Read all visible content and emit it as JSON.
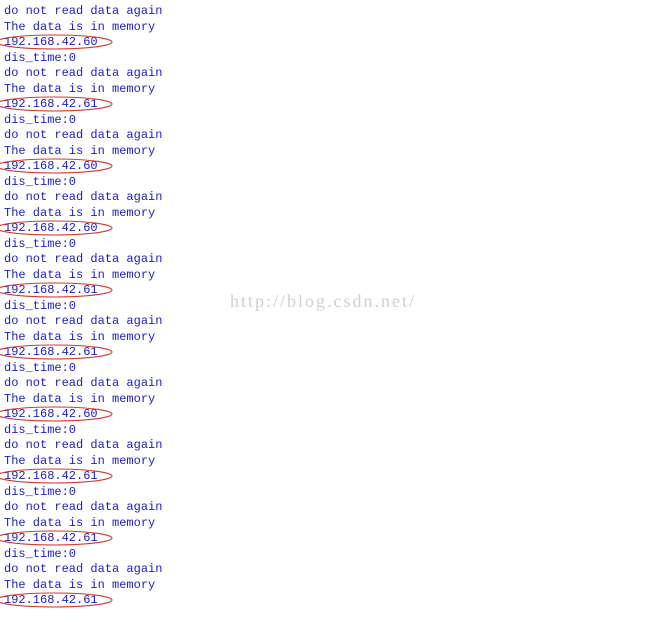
{
  "watermark": "http://blog.csdn.net/",
  "blocks": [
    {
      "msg1": "do not read data again",
      "msg2": "The data is in memory",
      "ip": "192.168.42.60",
      "dis": "dis_time:0"
    },
    {
      "msg1": "do not read data again",
      "msg2": "The data is in memory",
      "ip": "192.168.42.61",
      "dis": "dis_time:0"
    },
    {
      "msg1": "do not read data again",
      "msg2": "The data is in memory",
      "ip": "192.168.42.60",
      "dis": "dis_time:0"
    },
    {
      "msg1": "do not read data again",
      "msg2": "The data is in memory",
      "ip": "192.168.42.60",
      "dis": "dis_time:0"
    },
    {
      "msg1": "do not read data again",
      "msg2": "The data is in memory",
      "ip": "192.168.42.61",
      "dis": "dis_time:0"
    },
    {
      "msg1": "do not read data again",
      "msg2": "The data is in memory",
      "ip": "192.168.42.61",
      "dis": "dis_time:0"
    },
    {
      "msg1": "do not read data again",
      "msg2": "The data is in memory",
      "ip": "192.168.42.60",
      "dis": "dis_time:0"
    },
    {
      "msg1": "do not read data again",
      "msg2": "The data is in memory",
      "ip": "192.168.42.61",
      "dis": "dis_time:0"
    },
    {
      "msg1": "do not read data again",
      "msg2": "The data is in memory",
      "ip": "192.168.42.61",
      "dis": "dis_time:0"
    },
    {
      "msg1": "do not read data again",
      "msg2": "The data is in memory",
      "ip": "192.168.42.61",
      "dis": ""
    }
  ]
}
